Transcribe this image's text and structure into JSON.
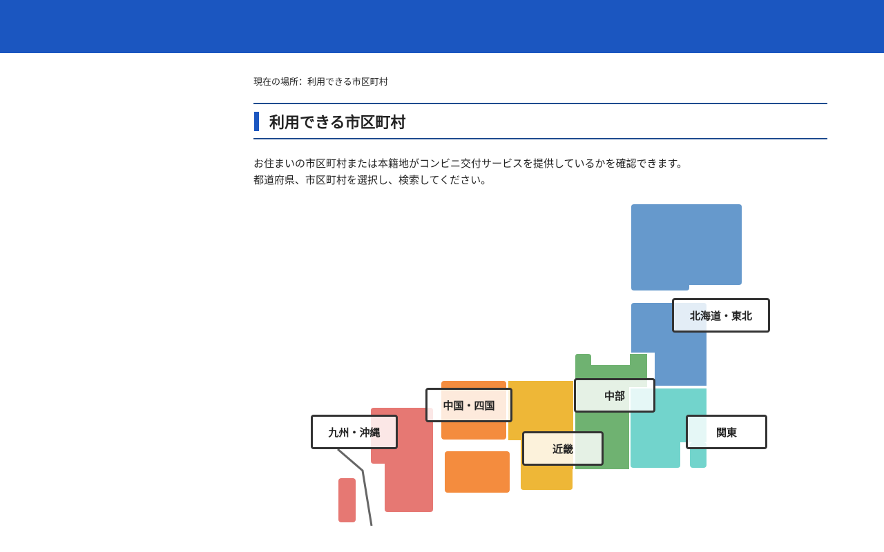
{
  "breadcrumb": {
    "text": "現在の場所：利用できる市区町村"
  },
  "page": {
    "title": "利用できる市区町村",
    "description": [
      "お住まいの市区町村または本籍地がコンビニ交付サービスを提供しているかを確認できます。",
      "都道府県、市区町村を選択し、検索してください。"
    ]
  },
  "map": {
    "regions": {
      "hokkaido_tohoku": {
        "label": "北海道・東北",
        "color": "#6699cc"
      },
      "kanto": {
        "label": "関東",
        "color": "#72d4cc"
      },
      "chubu": {
        "label": "中部",
        "color": "#6fb271"
      },
      "kinki": {
        "label": "近畿",
        "color": "#eeb737"
      },
      "chugoku_shikoku": {
        "label": "中国・四国",
        "color": "#f48c3e"
      },
      "kyushu_okinawa": {
        "label": "九州・沖縄",
        "color": "#e67873"
      }
    }
  },
  "colors": {
    "header": "#1b56c0",
    "rule": "#1e4b8f"
  }
}
